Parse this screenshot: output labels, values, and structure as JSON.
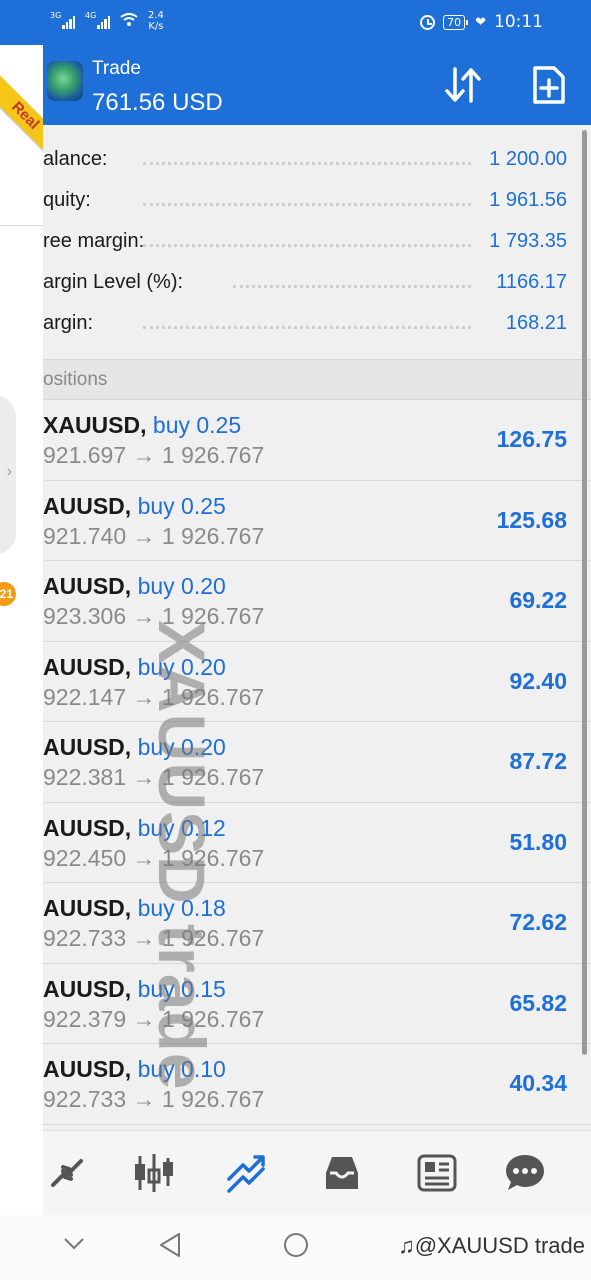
{
  "status_bar": {
    "sim1": "3G",
    "sim2": "4G",
    "speed_value": "2.4",
    "speed_unit": "K/s",
    "battery": "70",
    "time": "10:11"
  },
  "header": {
    "title": "Trade",
    "subtitle": "761.56 USD"
  },
  "drawer": {
    "ribbon": "Real",
    "badge": "21"
  },
  "summary": [
    {
      "label": "alance:",
      "value": "1 200.00"
    },
    {
      "label": "quity:",
      "value": "1 961.56"
    },
    {
      "label": "ree margin:",
      "value": "1 793.35"
    },
    {
      "label": "argin Level (%):",
      "value": "1166.17"
    },
    {
      "label": "argin:",
      "value": "168.21"
    }
  ],
  "positions_header": "ositions",
  "positions": [
    {
      "symbol": "XAUUSD",
      "type": "buy 0.25",
      "prices": "921.697 → 1 926.767",
      "profit": "126.75"
    },
    {
      "symbol": "AUUSD",
      "type": "buy 0.25",
      "prices": "921.740 → 1 926.767",
      "profit": "125.68"
    },
    {
      "symbol": "AUUSD",
      "type": "buy 0.20",
      "prices": "923.306 → 1 926.767",
      "profit": "69.22"
    },
    {
      "symbol": "AUUSD",
      "type": "buy 0.20",
      "prices": "922.147 → 1 926.767",
      "profit": "92.40"
    },
    {
      "symbol": "AUUSD",
      "type": "buy 0.20",
      "prices": "922.381 → 1 926.767",
      "profit": "87.72"
    },
    {
      "symbol": "AUUSD",
      "type": "buy 0.12",
      "prices": "922.450 → 1 926.767",
      "profit": "51.80"
    },
    {
      "symbol": "AUUSD",
      "type": "buy 0.18",
      "prices": "922.733 → 1 926.767",
      "profit": "72.62"
    },
    {
      "symbol": "AUUSD",
      "type": "buy 0.15",
      "prices": "922.379 → 1 926.767",
      "profit": "65.82"
    },
    {
      "symbol": "AUUSD",
      "type": "buy 0.10",
      "prices": "922.733 → 1 926.767",
      "profit": "40.34"
    }
  ],
  "watermark": "XAUUSD trade",
  "nav_tag": "@XAUUSD trade",
  "tabs": [
    {
      "name": "quotes",
      "icon": "quotes-icon",
      "active": false
    },
    {
      "name": "charts",
      "icon": "chart-candles-icon",
      "active": false
    },
    {
      "name": "trade",
      "icon": "trade-icon",
      "active": true
    },
    {
      "name": "history",
      "icon": "history-inbox-icon",
      "active": false
    },
    {
      "name": "news",
      "icon": "news-icon",
      "active": false
    },
    {
      "name": "messages",
      "icon": "chat-icon",
      "active": false
    }
  ],
  "colors": {
    "accent": "#1e6fd8",
    "muted": "#8a8a8a",
    "text": "#1a1a1a",
    "ribbon": "#f5c518",
    "badge": "#f59b14"
  }
}
